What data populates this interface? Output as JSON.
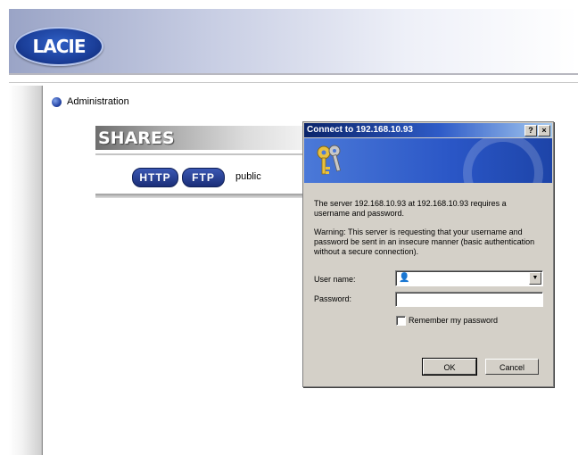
{
  "header": {
    "logo_text": "LACIE",
    "brand_color": "#1b3f9a"
  },
  "nav": {
    "admin_label": "Administration",
    "admin_icon": "globe-icon"
  },
  "shares": {
    "title": "SHARES",
    "http_label": "HTTP",
    "ftp_label": "FTP",
    "share_name": "public"
  },
  "dialog": {
    "title": "Connect to 192.168.10.93",
    "help_label": "?",
    "close_label": "×",
    "banner_icon": "keys-icon",
    "message1": "The server 192.168.10.93 at 192.168.10.93 requires a username and password.",
    "message2": "Warning: This server is requesting that your username and password be sent in an insecure manner (basic authentication without a secure connection).",
    "username_label": "User name:",
    "username_value": "",
    "password_label": "Password:",
    "password_value": "",
    "remember_label": "Remember my password",
    "remember_checked": false,
    "ok_label": "OK",
    "cancel_label": "Cancel"
  }
}
